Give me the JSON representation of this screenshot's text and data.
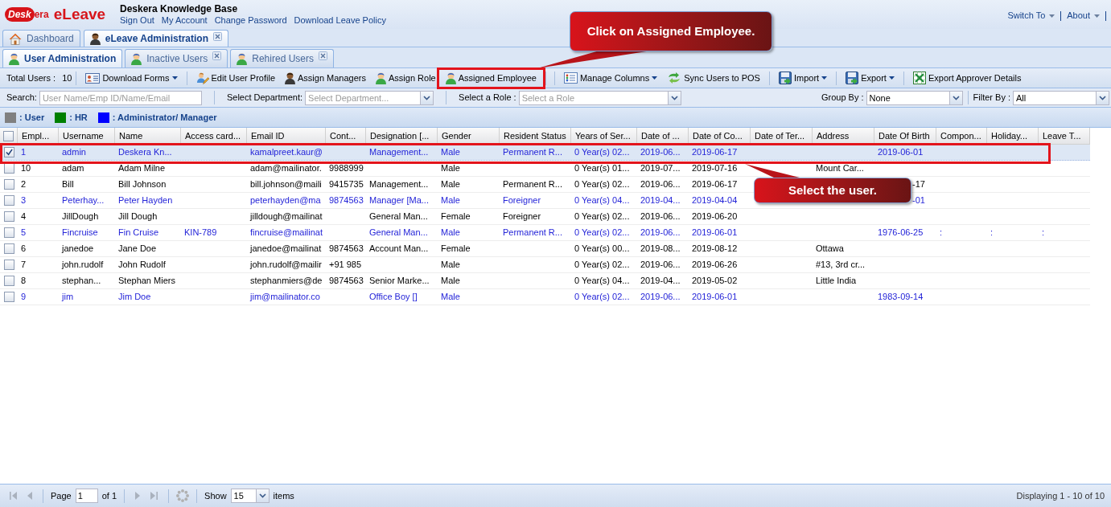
{
  "header": {
    "logo": {
      "mark": "Desk",
      "suffix": "era",
      "product": "eLeave"
    },
    "title": "Deskera Knowledge Base",
    "links": [
      "Sign Out",
      "My Account",
      "Change Password",
      "Download Leave Policy"
    ],
    "menus": [
      "Switch To",
      "About"
    ]
  },
  "main_tabs": [
    {
      "label": "Dashboard",
      "kind": "home",
      "selected": false,
      "closable": false
    },
    {
      "label": "eLeave Administration",
      "kind": "manager",
      "selected": true,
      "closable": true
    }
  ],
  "sub_tabs": [
    {
      "label": "User Administration",
      "kind": "person",
      "selected": true,
      "closable": false
    },
    {
      "label": "Inactive Users",
      "kind": "person",
      "selected": false,
      "closable": true
    },
    {
      "label": "Rehired Users",
      "kind": "person",
      "selected": false,
      "closable": true
    }
  ],
  "toolbar": {
    "total_label": "Total Users :",
    "total_value": "10",
    "items": [
      {
        "kind": "separator"
      },
      {
        "kind": "form",
        "label": "Download Forms",
        "menu": true,
        "highlighted": false
      },
      {
        "kind": "separator"
      },
      {
        "kind": "edit-user",
        "label": "Edit User Profile",
        "menu": false,
        "highlighted": false
      },
      {
        "kind": "manager",
        "label": "Assign Managers",
        "menu": false,
        "highlighted": false
      },
      {
        "kind": "person",
        "label": "Assign Role",
        "menu": false,
        "highlighted": false
      },
      {
        "kind": "person",
        "label": "Assigned Employee",
        "menu": false,
        "highlighted": true
      },
      {
        "kind": "separator"
      },
      {
        "kind": "separator"
      },
      {
        "kind": "columns",
        "label": "Manage Columns",
        "menu": true,
        "highlighted": false
      },
      {
        "kind": "sync",
        "label": "Sync Users to POS",
        "menu": false,
        "highlighted": false
      },
      {
        "kind": "separator"
      },
      {
        "kind": "disk",
        "label": "Import",
        "menu": true,
        "highlighted": false
      },
      {
        "kind": "separator"
      },
      {
        "kind": "disk",
        "label": "Export",
        "menu": true,
        "highlighted": false
      },
      {
        "kind": "separator"
      },
      {
        "kind": "sheet",
        "label": "Export Approver Details",
        "menu": false,
        "highlighted": false
      }
    ]
  },
  "filters": {
    "left": [
      {
        "kind": "text",
        "label": "Search:",
        "placeholder": "User Name/Emp ID/Name/Email"
      },
      {
        "kind": "combo",
        "label": "Select Department:",
        "placeholder": "Select Department..."
      },
      {
        "kind": "combo",
        "label": "Select a Role :",
        "placeholder": "Select a Role"
      }
    ],
    "right": [
      {
        "kind": "combo",
        "label": "Group By :",
        "value": "None"
      },
      {
        "kind": "combo",
        "label": "Filter By :",
        "value": "All"
      }
    ]
  },
  "legend": [
    {
      "label": ": User",
      "color": "#808080"
    },
    {
      "label": ": HR",
      "color": "#008000"
    },
    {
      "label": ": Administrator/ Manager",
      "color": "#0000ff"
    }
  ],
  "table": {
    "select_all_checked": false,
    "columns": [
      "Empl...",
      "Username",
      "Name",
      "Access card...",
      "Email ID",
      "Cont...",
      "Designation [...",
      "Gender",
      "Resident Status",
      "Years of Ser...",
      "Date of ...",
      "Date of Co...",
      "Date of Ter...",
      "Address",
      "Date Of Birth",
      "Compon...",
      "Holiday...",
      "Leave T..."
    ],
    "rows": [
      {
        "selected": true,
        "checked": true,
        "highlighted": true,
        "color": "#2424d8",
        "cells": [
          "1",
          "admin",
          "Deskera Kn...",
          null,
          "kamalpreet.kaur@",
          null,
          "Management...",
          "Male",
          "Permanent R...",
          "0 Year(s) 02...",
          "2019-06...",
          "2019-06-17",
          null,
          null,
          "2019-06-01",
          null,
          null,
          null
        ]
      },
      {
        "selected": false,
        "checked": false,
        "highlighted": false,
        "color": "#000000",
        "cells": [
          "10",
          "adam",
          "Adam Milne",
          null,
          "adam@mailinator.",
          "9988999",
          null,
          "Male",
          null,
          "0 Year(s) 01...",
          "2019-07...",
          "2019-07-16",
          null,
          "Mount Car...",
          null,
          null,
          null,
          null
        ]
      },
      {
        "selected": false,
        "checked": false,
        "highlighted": false,
        "color": "#000000",
        "cells": [
          "2",
          "Bill",
          "Bill Johnson",
          null,
          "bill.johnson@maili",
          "9415735",
          "Management...",
          "Male",
          "Permanent R...",
          "0 Year(s) 02...",
          "2019-06...",
          "2019-06-17",
          null,
          null,
          {
            "text": "-17",
            "kind": "tail"
          },
          null,
          null,
          null
        ]
      },
      {
        "selected": false,
        "checked": false,
        "highlighted": false,
        "color": "#2424d8",
        "cells": [
          "3",
          "Peterhay...",
          "Peter Hayden",
          null,
          "peterhayden@ma",
          "9874563",
          "Manager [Ma...",
          "Male",
          "Foreigner",
          "0 Year(s) 04...",
          "2019-04...",
          "2019-04-04",
          null,
          null,
          {
            "text": "-01",
            "kind": "tail"
          },
          null,
          null,
          null
        ]
      },
      {
        "selected": false,
        "checked": false,
        "highlighted": false,
        "color": "#000000",
        "cells": [
          "4",
          "JillDough",
          "Jill Dough",
          null,
          "jilldough@mailinat",
          null,
          "General Man...",
          "Female",
          "Foreigner",
          "0 Year(s) 02...",
          "2019-06...",
          "2019-06-20",
          null,
          null,
          null,
          null,
          null,
          null
        ]
      },
      {
        "selected": false,
        "checked": false,
        "highlighted": false,
        "color": "#2424d8",
        "cells": [
          "5",
          "Fincruise",
          "Fin Cruise",
          "KIN-789",
          "fincruise@mailinat",
          null,
          "General Man...",
          "Male",
          "Permanent R...",
          "0 Year(s) 02...",
          "2019-06...",
          "2019-06-01",
          null,
          null,
          "1976-06-25",
          ":",
          ":",
          ":"
        ]
      },
      {
        "selected": false,
        "checked": false,
        "highlighted": false,
        "color": "#000000",
        "cells": [
          "6",
          "janedoe",
          "Jane Doe",
          null,
          "janedoe@mailinat",
          "9874563",
          "Account Man...",
          "Female",
          null,
          "0 Year(s) 00...",
          "2019-08...",
          "2019-08-12",
          null,
          "Ottawa",
          null,
          null,
          null,
          null
        ]
      },
      {
        "selected": false,
        "checked": false,
        "highlighted": false,
        "color": "#000000",
        "cells": [
          "7",
          "john.rudolf",
          "John Rudolf",
          null,
          "john.rudolf@mailir",
          "+91 985",
          null,
          "Male",
          null,
          "0 Year(s) 02...",
          "2019-06...",
          "2019-06-26",
          null,
          "#13, 3rd cr...",
          null,
          null,
          null,
          null
        ]
      },
      {
        "selected": false,
        "checked": false,
        "highlighted": false,
        "color": "#000000",
        "cells": [
          "8",
          "stephan...",
          "Stephan Miers",
          null,
          "stephanmiers@de",
          "9874563",
          "Senior Marke...",
          "Male",
          null,
          "0 Year(s) 04...",
          "2019-04...",
          "2019-05-02",
          null,
          "Little India",
          null,
          null,
          null,
          null
        ]
      },
      {
        "selected": false,
        "checked": false,
        "highlighted": false,
        "color": "#2424d8",
        "cells": [
          "9",
          "jim",
          "Jim Doe",
          null,
          "jim@mailinator.co",
          null,
          "Office Boy []",
          "Male",
          null,
          "0 Year(s) 02...",
          "2019-06...",
          "2019-06-01",
          null,
          null,
          "1983-09-14",
          null,
          null,
          null
        ]
      }
    ]
  },
  "pager": {
    "nav": [
      {
        "kind": "first",
        "disabled": true
      },
      {
        "kind": "prev",
        "disabled": true
      },
      {
        "kind": "next",
        "disabled": true
      },
      {
        "kind": "last",
        "disabled": true
      }
    ],
    "page_label": "Page",
    "page": "1",
    "page_total": "of 1",
    "show_label": "Show",
    "page_size": "15",
    "items_label": "items",
    "summary": "Displaying 1 - 10 of 10"
  },
  "callouts": [
    {
      "text": "Click on Assigned Employee."
    },
    {
      "text": "Select the user."
    }
  ]
}
